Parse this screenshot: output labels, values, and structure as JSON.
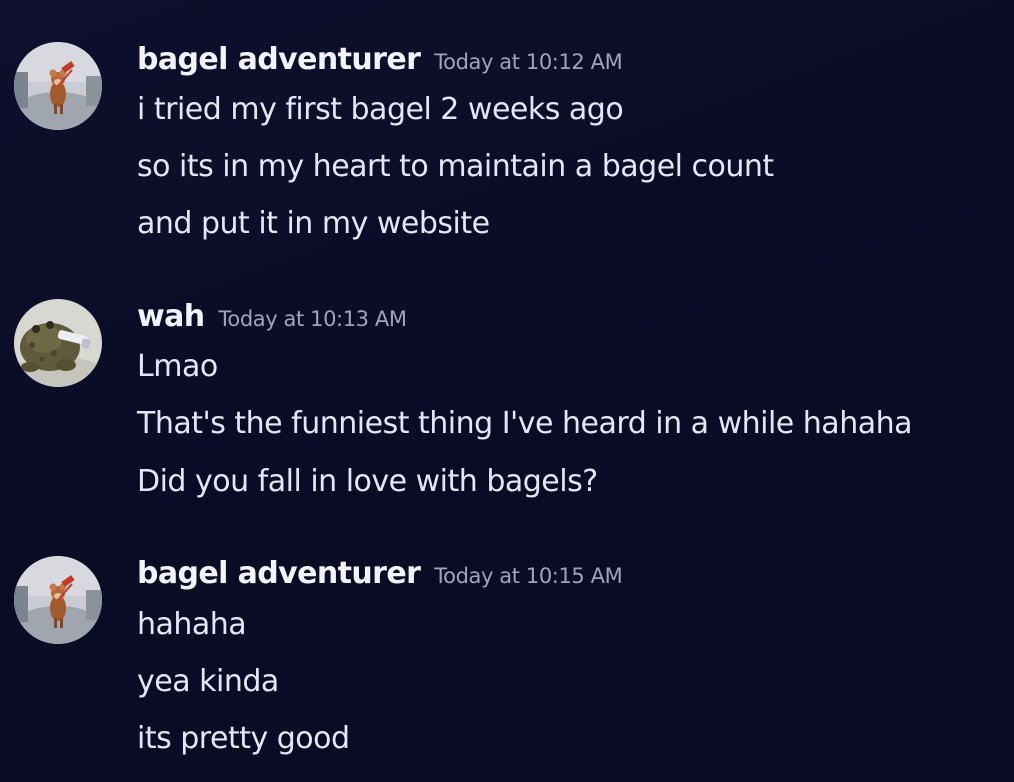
{
  "messages": [
    {
      "username": "bagel adventurer",
      "timestamp": "Today at 10:12 AM",
      "avatar_icon": "mouse-figurine-avatar-icon",
      "lines": [
        "i tried my first bagel 2 weeks ago",
        "so its in my heart to maintain a bagel count",
        "and put it in my website"
      ]
    },
    {
      "username": "wah",
      "timestamp": "Today at 10:13 AM",
      "avatar_icon": "toad-avatar-icon",
      "lines": [
        "Lmao",
        "That's the funniest thing I've heard in a while hahaha",
        "Did you fall in love with bagels?"
      ]
    },
    {
      "username": "bagel adventurer",
      "timestamp": "Today at 10:15 AM",
      "avatar_icon": "mouse-figurine-avatar-icon",
      "lines": [
        "hahaha",
        "yea kinda",
        "its pretty good"
      ]
    }
  ],
  "colors": {
    "background": "#0c0e29",
    "username": "#f2f3fb",
    "timestamp": "#9fa3bd",
    "message_text": "#e4e6f5"
  }
}
